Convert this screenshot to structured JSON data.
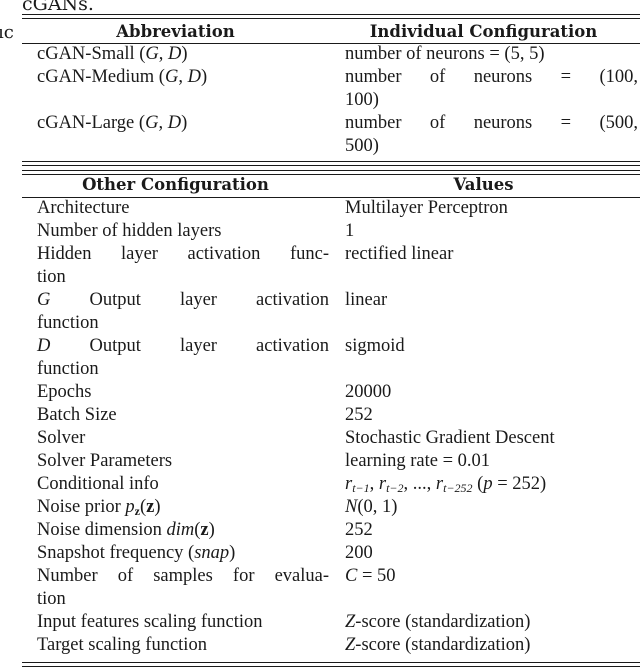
{
  "caption": "cGANs.",
  "margin_fragment": "ıc",
  "table1": {
    "headers": [
      "Abbreviation",
      "Individual Configuration"
    ],
    "rows": [
      {
        "abbr": "cGAN-Small",
        "abbr_suffix": "(G, D)",
        "config_line1": "number of neurons = (5, 5)",
        "config_line2": ""
      },
      {
        "abbr": "cGAN-Medium",
        "abbr_suffix": "(G, D)",
        "config_line1": "number of neurons = (100,",
        "config_line2": "100)"
      },
      {
        "abbr": "cGAN-Large",
        "abbr_suffix": "(G, D)",
        "config_line1": "number of neurons = (500,",
        "config_line2": "500)"
      }
    ]
  },
  "table2": {
    "headers": [
      "Other Configuration",
      "Values"
    ],
    "rows": [
      {
        "label": "Architecture",
        "value": "Multilayer Perceptron"
      },
      {
        "label": "Number of hidden layers",
        "value": "1"
      },
      {
        "label_line1": "Hidden layer activation func-",
        "label_line2": "tion",
        "value": "rectified linear"
      },
      {
        "label_prefix": "G",
        "label_line1": "Output layer activation",
        "label_line2": "function",
        "value": "linear"
      },
      {
        "label_prefix": "D",
        "label_line1": "Output layer activation",
        "label_line2": "function",
        "value": "sigmoid"
      },
      {
        "label": "Epochs",
        "value": "20000"
      },
      {
        "label": "Batch Size",
        "value": "252"
      },
      {
        "label": "Solver",
        "value": "Stochastic Gradient Descent"
      },
      {
        "label": "Solver Parameters",
        "value": "learning rate = 0.01"
      },
      {
        "label": "Conditional info",
        "value": "r_{t−1}, r_{t−2}, ..., r_{t−252} (p = 252)"
      },
      {
        "label": "Noise prior p_z(z)",
        "value": "N(0, 1)"
      },
      {
        "label": "Noise dimension dim(z)",
        "value": "252"
      },
      {
        "label": "Snapshot frequency (snap)",
        "value": "200"
      },
      {
        "label_line1": "Number of samples for evalua-",
        "label_line2": "tion",
        "value": "C = 50"
      },
      {
        "label": "Input features scaling function",
        "value": "Z-score (standardization)"
      },
      {
        "label": "Target scaling function",
        "value": "Z-score (standardization)"
      }
    ]
  },
  "math": {
    "G": "G",
    "D": "D",
    "comma": ",",
    "cond_r": "r",
    "cond_sub1": "t−1",
    "cond_sub2": "t−2",
    "cond_sub3": "t−252",
    "cond_p": "p",
    "cond_eq": " = 252)",
    "noise_p": "p",
    "noise_sub": "z",
    "noise_z": "z",
    "dim": "dim",
    "snap": "snap",
    "C": "C",
    "eq50": " = 50",
    "N": "N",
    "N_args": "(0, 1)",
    "Z": "Z",
    "zscore_rest": "-score (standardization)"
  }
}
